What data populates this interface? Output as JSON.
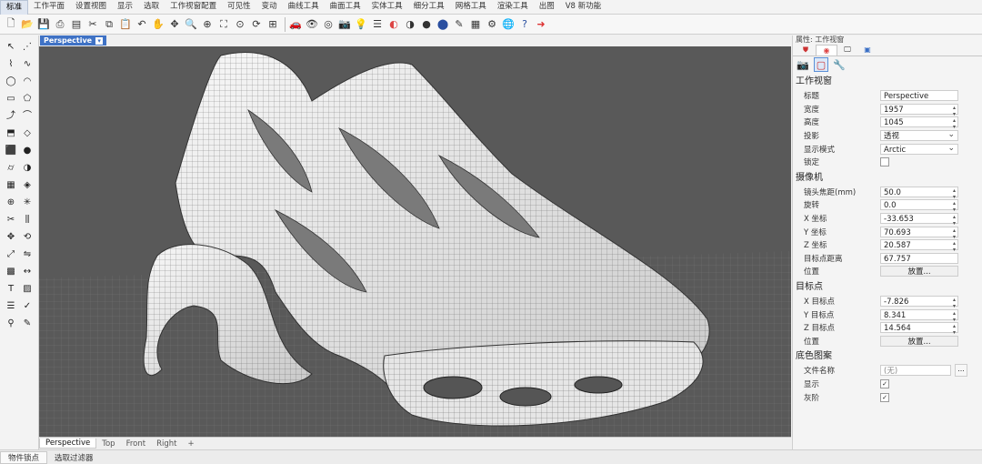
{
  "menu": {
    "tabs": [
      "标准",
      "工作平面",
      "设置视图",
      "显示",
      "选取",
      "工作视窗配置",
      "可见性",
      "变动",
      "曲线工具",
      "曲面工具",
      "实体工具",
      "细分工具",
      "网格工具",
      "渲染工具",
      "出图",
      "V8 新功能"
    ],
    "active": "标准"
  },
  "toolbar_icons": [
    "new-file-icon",
    "open-file-icon",
    "save-icon",
    "print-icon",
    "properties-icon",
    "cut-icon",
    "copy-icon",
    "paste-icon",
    "pan-hand-icon",
    "rotate-view-icon",
    "zoom-icon",
    "zoom-window-icon",
    "zoom-extents-icon",
    "zoom-selected-icon",
    "rotate-camera-icon",
    "four-views-icon",
    "car-icon",
    "eye-icon",
    "target-icon",
    "camera-icon",
    "bulb-icon",
    "layers-icon",
    "material-icon",
    "display-icon",
    "sphere-icon",
    "render-icon",
    "pen-icon",
    "print-setup-icon",
    "gear-icon",
    "globe-icon",
    "help-icon",
    "arrow-icon"
  ],
  "viewport": {
    "active_label": "Perspective",
    "tabs": [
      "Perspective",
      "Top",
      "Front",
      "Right"
    ],
    "add_tab": "+"
  },
  "status": {
    "items": [
      "物件锁点",
      "选取过滤器"
    ]
  },
  "panel": {
    "title": "属性: 工作视窗",
    "section_viewport": "工作视窗",
    "rows_viewport": [
      {
        "label": "标题",
        "value": "Perspective",
        "kind": "text"
      },
      {
        "label": "宽度",
        "value": "1957",
        "kind": "spin"
      },
      {
        "label": "高度",
        "value": "1045",
        "kind": "spin"
      },
      {
        "label": "投影",
        "value": "透视",
        "kind": "dd"
      },
      {
        "label": "显示模式",
        "value": "Arctic",
        "kind": "dd"
      },
      {
        "label": "锁定",
        "value": "",
        "kind": "check"
      }
    ],
    "section_camera": "摄像机",
    "rows_camera": [
      {
        "label": "镜头焦距(mm)",
        "value": "50.0",
        "kind": "spin"
      },
      {
        "label": "旋转",
        "value": "0.0",
        "kind": "spin"
      },
      {
        "label": "X 坐标",
        "value": "-33.653",
        "kind": "spin"
      },
      {
        "label": "Y 坐标",
        "value": "70.693",
        "kind": "spin"
      },
      {
        "label": "Z 坐标",
        "value": "20.587",
        "kind": "spin"
      },
      {
        "label": "目标点距离",
        "value": "67.757",
        "kind": "text"
      },
      {
        "label": "位置",
        "value": "放置...",
        "kind": "btn"
      }
    ],
    "section_target": "目标点",
    "rows_target": [
      {
        "label": "X 目标点",
        "value": "-7.826",
        "kind": "spin"
      },
      {
        "label": "Y 目标点",
        "value": "8.341",
        "kind": "spin"
      },
      {
        "label": "Z 目标点",
        "value": "14.564",
        "kind": "spin"
      },
      {
        "label": "位置",
        "value": "放置...",
        "kind": "btn"
      }
    ],
    "section_wallpaper": "底色图案",
    "rows_wallpaper": [
      {
        "label": "文件名称",
        "value": "(无)",
        "kind": "file"
      },
      {
        "label": "显示",
        "value": "✓",
        "kind": "check"
      },
      {
        "label": "灰阶",
        "value": "✓",
        "kind": "check"
      }
    ]
  }
}
